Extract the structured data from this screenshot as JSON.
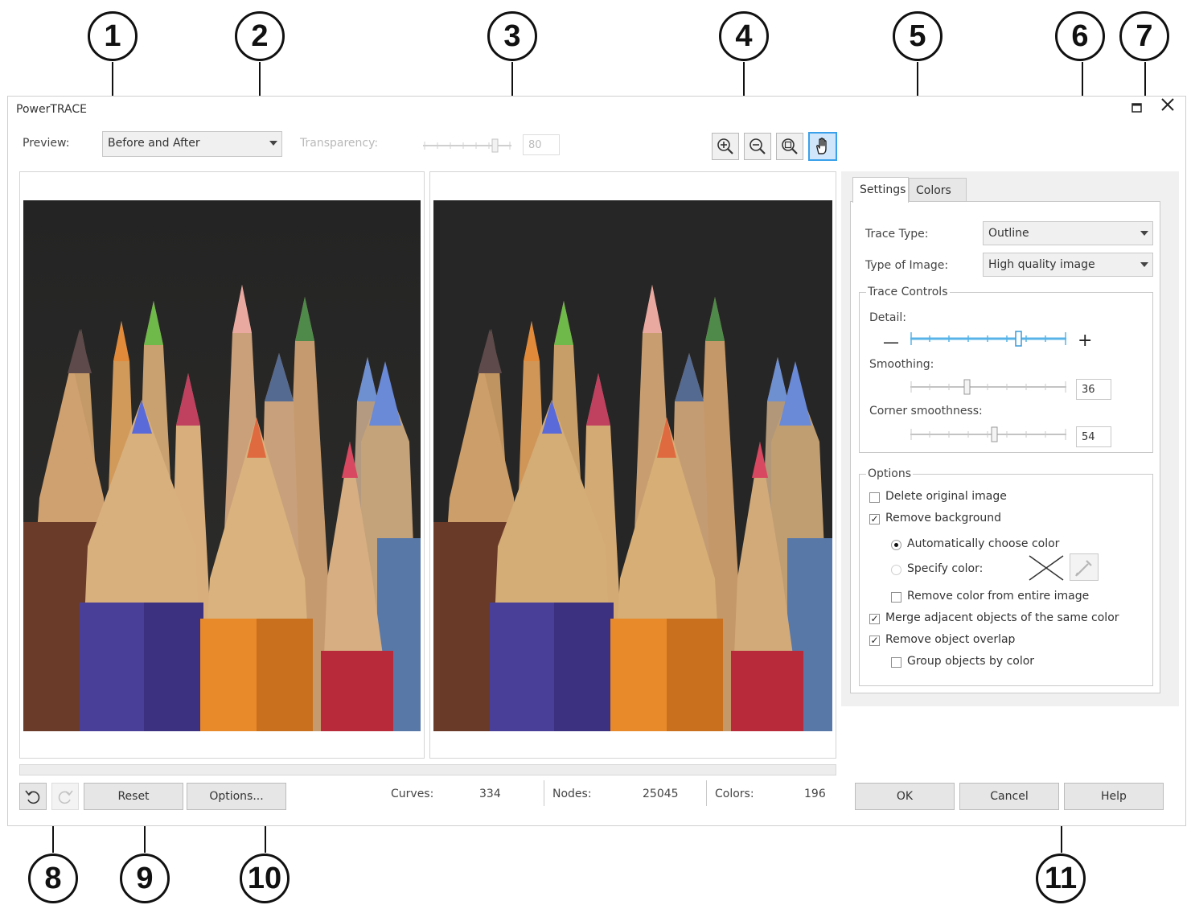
{
  "window": {
    "title": "PowerTRACE",
    "maximize_icon": "maximize-icon",
    "close_icon": "close-icon"
  },
  "toolbar": {
    "preview_label": "Preview:",
    "preview_value": "Before and After",
    "transparency_label": "Transparency:",
    "transparency_value": "80",
    "zoom_tools": [
      "zoom-in-icon",
      "zoom-out-icon",
      "zoom-fit-icon",
      "pan-hand-icon"
    ],
    "active_tool": "pan-hand-icon"
  },
  "tabs": [
    {
      "label": "Settings",
      "active": true
    },
    {
      "label": "Colors",
      "active": false
    }
  ],
  "settings": {
    "trace_type_label": "Trace Type:",
    "trace_type_value": "Outline",
    "image_type_label": "Type of Image:",
    "image_type_value": "High quality image",
    "trace_controls": {
      "legend": "Trace Controls",
      "detail_label": "Detail:",
      "detail_minus": "—",
      "detail_plus": "+",
      "smoothing_label": "Smoothing:",
      "smoothing_value": "36",
      "corner_label": "Corner smoothness:",
      "corner_value": "54"
    },
    "options": {
      "legend": "Options",
      "delete_original": "Delete original image",
      "remove_background": "Remove background",
      "auto_color": "Automatically choose color",
      "specify_color": "Specify color:",
      "remove_color_entire": "Remove color from entire image",
      "merge_adjacent": "Merge adjacent objects of the same color",
      "remove_overlap": "Remove object overlap",
      "group_by_color": "Group objects by color"
    }
  },
  "footer": {
    "reset": "Reset",
    "options": "Options...",
    "curves_label": "Curves:",
    "curves_value": "334",
    "nodes_label": "Nodes:",
    "nodes_value": "25045",
    "colors_label": "Colors:",
    "colors_value": "196",
    "ok": "OK",
    "cancel": "Cancel",
    "help": "Help"
  },
  "callouts": [
    "1",
    "2",
    "3",
    "4",
    "5",
    "6",
    "7",
    "8",
    "9",
    "10",
    "11"
  ]
}
